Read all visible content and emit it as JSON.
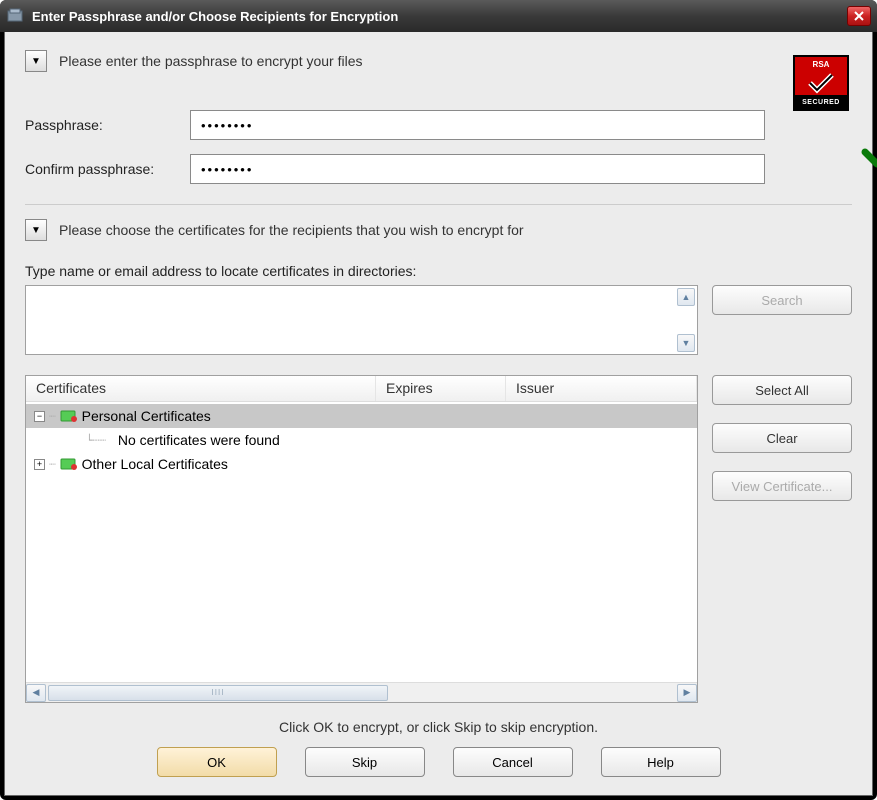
{
  "title": "Enter Passphrase and/or Choose Recipients for Encryption",
  "section1": {
    "label": "Please enter the passphrase to encrypt your files"
  },
  "rsa": {
    "top": "RSA",
    "bottom": "SECURED"
  },
  "passphrase": {
    "label": "Passphrase:",
    "value": "••••••••",
    "confirm_label": "Confirm passphrase:",
    "confirm_value": "••••••••"
  },
  "section2": {
    "label": "Please choose the certificates for the recipients that you wish to encrypt for"
  },
  "locate_label": "Type name or email address to locate certificates in directories:",
  "search_btn": "Search",
  "columns": {
    "cert": "Certificates",
    "expires": "Expires",
    "issuer": "Issuer"
  },
  "tree": {
    "personal": "Personal Certificates",
    "none": "No certificates were found",
    "other": "Other Local Certificates"
  },
  "side": {
    "select_all": "Select All",
    "clear": "Clear",
    "view": "View Certificate..."
  },
  "footer": "Click OK to encrypt, or click Skip to skip encryption.",
  "buttons": {
    "ok": "OK",
    "skip": "Skip",
    "cancel": "Cancel",
    "help": "Help"
  }
}
